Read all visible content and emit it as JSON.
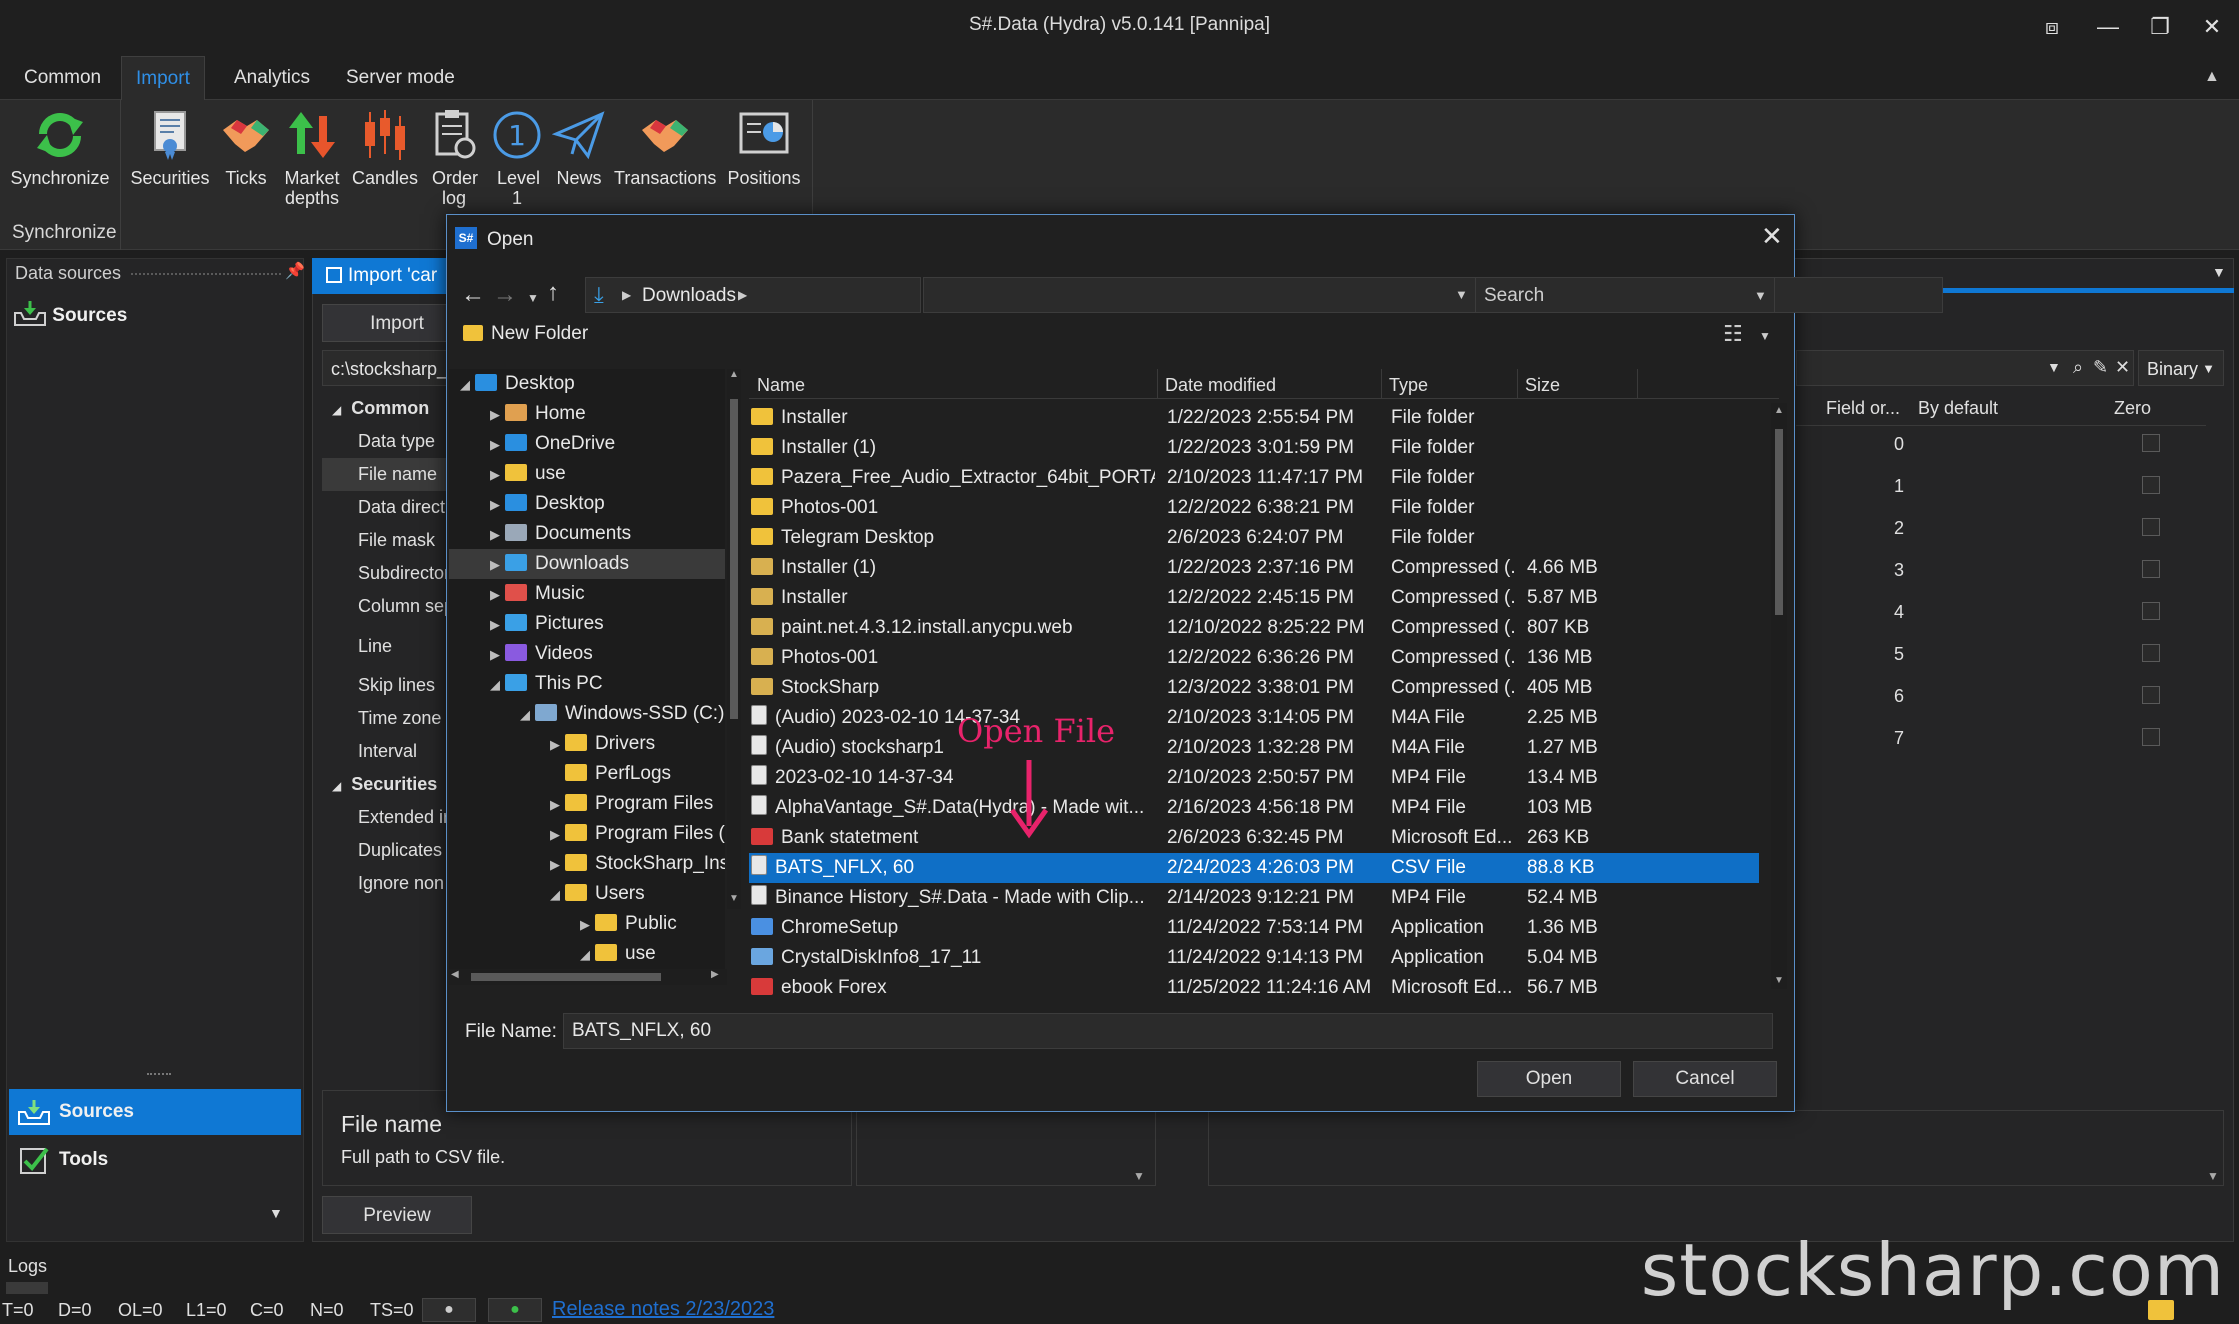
{
  "window": {
    "title": "S#.Data (Hydra) v5.0.141 [Pannipa]"
  },
  "ribbon": {
    "tabs": [
      "Common",
      "Import",
      "Analytics",
      "Server mode"
    ],
    "active_tab": "Import",
    "synchronize_label": "Synchronize",
    "synchronize_group_label": "Synchronize",
    "buttons": [
      {
        "label": "Securities"
      },
      {
        "label": "Ticks"
      },
      {
        "label": "Market depths"
      },
      {
        "label": "Candles"
      },
      {
        "label": "Order log"
      },
      {
        "label": "Level 1"
      },
      {
        "label": "News"
      },
      {
        "label": "Transactions"
      },
      {
        "label": "Positions"
      }
    ]
  },
  "left_pane": {
    "header": "Data sources",
    "tree_item": "Sources",
    "nav": [
      {
        "label": "Sources",
        "selected": true
      },
      {
        "label": "Tools",
        "selected": false
      }
    ]
  },
  "import_panel": {
    "tab_label": "Import 'car",
    "import_button": "Import",
    "path_value": "c:\\stocksharp_i",
    "properties": [
      {
        "label": "Common",
        "category": true
      },
      {
        "label": "Data type"
      },
      {
        "label": "File name",
        "selected": true
      },
      {
        "label": "Data direct"
      },
      {
        "label": "File mask"
      },
      {
        "label": "Subdirector"
      },
      {
        "label": "Column sep"
      },
      {
        "label": "Line"
      },
      {
        "label": "Skip lines"
      },
      {
        "label": "Time zone"
      },
      {
        "label": "Interval"
      },
      {
        "label": "Securities",
        "category": true
      },
      {
        "label": "Extended ir"
      },
      {
        "label": "Duplicates"
      },
      {
        "label": "Ignore non"
      }
    ],
    "desc_title": "File name",
    "desc_text": "Full path to CSV file.",
    "preview_button": "Preview"
  },
  "fields_grid": {
    "format_value": "Binary",
    "columns": [
      "Field or...",
      "By default",
      "Zero"
    ],
    "rows": [
      "0",
      "1",
      "2",
      "3",
      "4",
      "5",
      "6",
      "7"
    ]
  },
  "dialog": {
    "title": "Open",
    "breadcrumb": "Downloads",
    "search_placeholder": "Search",
    "new_folder": "New Folder",
    "tree": [
      {
        "label": "Desktop",
        "level": 0,
        "caret": "open",
        "icon": "desktop"
      },
      {
        "label": "Home",
        "level": 1,
        "caret": "closed",
        "icon": "home"
      },
      {
        "label": "OneDrive",
        "level": 1,
        "caret": "closed",
        "icon": "cloud"
      },
      {
        "label": "use",
        "level": 1,
        "caret": "closed",
        "icon": "folder"
      },
      {
        "label": "Desktop",
        "level": 1,
        "caret": "closed",
        "icon": "desktop"
      },
      {
        "label": "Documents",
        "level": 1,
        "caret": "closed",
        "icon": "docs"
      },
      {
        "label": "Downloads",
        "level": 1,
        "caret": "closed",
        "icon": "download",
        "selected": true
      },
      {
        "label": "Music",
        "level": 1,
        "caret": "closed",
        "icon": "music"
      },
      {
        "label": "Pictures",
        "level": 1,
        "caret": "closed",
        "icon": "pictures"
      },
      {
        "label": "Videos",
        "level": 1,
        "caret": "closed",
        "icon": "videos"
      },
      {
        "label": "This PC",
        "level": 1,
        "caret": "open",
        "icon": "pc"
      },
      {
        "label": "Windows-SSD (C:)",
        "level": 2,
        "caret": "open",
        "icon": "drive"
      },
      {
        "label": "Drivers",
        "level": 3,
        "caret": "closed",
        "icon": "folder"
      },
      {
        "label": "PerfLogs",
        "level": 3,
        "caret": "",
        "icon": "folder"
      },
      {
        "label": "Program Files",
        "level": 3,
        "caret": "closed",
        "icon": "folder"
      },
      {
        "label": "Program Files (",
        "level": 3,
        "caret": "closed",
        "icon": "folder"
      },
      {
        "label": "StockSharp_Ins",
        "level": 3,
        "caret": "closed",
        "icon": "folder"
      },
      {
        "label": "Users",
        "level": 3,
        "caret": "open",
        "icon": "folder"
      },
      {
        "label": "Public",
        "level": 4,
        "caret": "closed",
        "icon": "folder"
      },
      {
        "label": "use",
        "level": 4,
        "caret": "open",
        "icon": "folder"
      }
    ],
    "columns": {
      "name": "Name",
      "date": "Date modified",
      "type": "Type",
      "size": "Size"
    },
    "files": [
      {
        "name": "Installer",
        "date": "1/22/2023 2:55:54 PM",
        "type": "File folder",
        "size": "",
        "icon": "folder"
      },
      {
        "name": "Installer (1)",
        "date": "1/22/2023 3:01:59 PM",
        "type": "File folder",
        "size": "",
        "icon": "folder"
      },
      {
        "name": "Pazera_Free_Audio_Extractor_64bit_PORTA...",
        "date": "2/10/2023 11:47:17 PM",
        "type": "File folder",
        "size": "",
        "icon": "folder"
      },
      {
        "name": "Photos-001",
        "date": "12/2/2022 6:38:21 PM",
        "type": "File folder",
        "size": "",
        "icon": "folder"
      },
      {
        "name": "Telegram Desktop",
        "date": "2/6/2023 6:24:07 PM",
        "type": "File folder",
        "size": "",
        "icon": "folder"
      },
      {
        "name": "Installer (1)",
        "date": "1/22/2023 2:37:16 PM",
        "type": "Compressed (...",
        "size": "4.66 MB",
        "icon": "zip"
      },
      {
        "name": "Installer",
        "date": "12/2/2022 2:45:15 PM",
        "type": "Compressed (...",
        "size": "5.87 MB",
        "icon": "zip"
      },
      {
        "name": "paint.net.4.3.12.install.anycpu.web",
        "date": "12/10/2022 8:25:22 PM",
        "type": "Compressed (...",
        "size": "807 KB",
        "icon": "zip"
      },
      {
        "name": "Photos-001",
        "date": "12/2/2022 6:36:26 PM",
        "type": "Compressed (...",
        "size": "136 MB",
        "icon": "zip"
      },
      {
        "name": "StockSharp",
        "date": "12/3/2022 3:38:01 PM",
        "type": "Compressed (...",
        "size": "405 MB",
        "icon": "zip"
      },
      {
        "name": "(Audio) 2023-02-10 14-37-34",
        "date": "2/10/2023 3:14:05 PM",
        "type": "M4A File",
        "size": "2.25 MB",
        "icon": "media"
      },
      {
        "name": "(Audio) stocksharp1",
        "date": "2/10/2023 1:32:28 PM",
        "type": "M4A File",
        "size": "1.27 MB",
        "icon": "media"
      },
      {
        "name": "2023-02-10 14-37-34",
        "date": "2/10/2023 2:50:57 PM",
        "type": "MP4 File",
        "size": "13.4 MB",
        "icon": "media"
      },
      {
        "name": "AlphaVantage_S#.Data(Hydra) - Made wit...",
        "date": "2/16/2023 4:56:18 PM",
        "type": "MP4 File",
        "size": "103 MB",
        "icon": "media"
      },
      {
        "name": "Bank statetment",
        "date": "2/6/2023 6:32:45 PM",
        "type": "Microsoft Ed...",
        "size": "263 KB",
        "icon": "pdf"
      },
      {
        "name": "BATS_NFLX, 60",
        "date": "2/24/2023 4:26:03 PM",
        "type": "CSV File",
        "size": "88.8 KB",
        "icon": "csv",
        "selected": true
      },
      {
        "name": "Binance History_S#.Data - Made with Clip...",
        "date": "2/14/2023 9:12:21 PM",
        "type": "MP4 File",
        "size": "52.4 MB",
        "icon": "media"
      },
      {
        "name": "ChromeSetup",
        "date": "11/24/2022 7:53:14 PM",
        "type": "Application",
        "size": "1.36 MB",
        "icon": "chrome"
      },
      {
        "name": "CrystalDiskInfo8_17_11",
        "date": "11/24/2022 9:14:13 PM",
        "type": "Application",
        "size": "5.04 MB",
        "icon": "app"
      },
      {
        "name": "ebook Forex",
        "date": "11/25/2022 11:24:16 AM",
        "type": "Microsoft Ed...",
        "size": "56.7 MB",
        "icon": "pdf"
      }
    ],
    "file_name_label": "File Name:",
    "file_name_value": "BATS_NFLX, 60",
    "open_button": "Open",
    "cancel_button": "Cancel"
  },
  "annotation": "Open File",
  "status_bar": {
    "logs_label": "Logs",
    "counters": [
      "T=0",
      "D=0",
      "OL=0",
      "L1=0",
      "C=0",
      "N=0",
      "TS=0"
    ],
    "release_notes": "Release notes 2/23/2023"
  },
  "watermark": "stocksharp.com",
  "colors": {
    "accent": "#0f78d4",
    "active_tab": "#2f8fe6",
    "annotation": "#e8236b",
    "folder": "#f0c23b"
  }
}
